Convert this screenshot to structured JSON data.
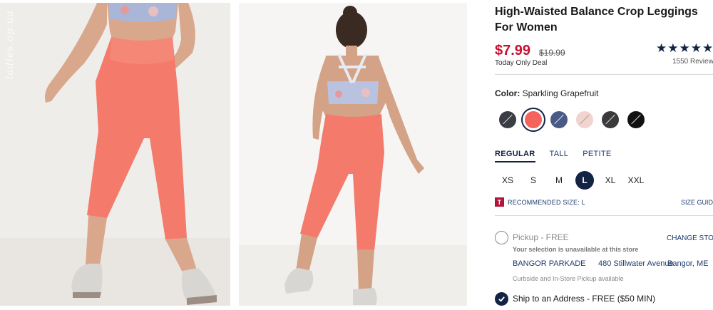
{
  "images": {
    "front": {
      "name": "front-view"
    },
    "back": {
      "name": "back-view"
    },
    "watermark": "ladies.op.ua"
  },
  "product": {
    "title": "High-Waisted Balance Crop Leggings For Women",
    "price": "$7.99",
    "original_price": "$19.99",
    "deal": "Today Only Deal",
    "stars": "★★★★★",
    "rating": 4.5,
    "reviews": "1550 Review"
  },
  "color": {
    "label": "Color:",
    "value": "Sparkling Grapefruit",
    "swatches": [
      {
        "name": "charcoal-print",
        "color": "#3b3d44"
      },
      {
        "name": "sparkling-grapefruit",
        "color": "#f4635c",
        "selected": true
      },
      {
        "name": "blue-heather",
        "color": "#4a5a86"
      },
      {
        "name": "floral-print",
        "color": "#f2d4cf"
      },
      {
        "name": "dark-gray",
        "color": "#3a3a3a"
      },
      {
        "name": "black",
        "color": "#111111"
      }
    ]
  },
  "fit": {
    "tabs": [
      "REGULAR",
      "TALL",
      "PETITE"
    ],
    "active": "REGULAR"
  },
  "sizes": {
    "options": [
      "XS",
      "S",
      "M",
      "L",
      "XL",
      "XXL"
    ],
    "selected": "L"
  },
  "recommended": {
    "badge": "T",
    "text": "RECOMMENDED SIZE: L",
    "size_guide": "SIZE GUID"
  },
  "fulfillment": {
    "pickup_label": "Pickup - FREE",
    "change_store": "CHANGE STOR",
    "unavailable": "Your selection is unavailable at this store",
    "store_name": "BANGOR PARKADE",
    "store_address": "480 Stillwater Avenue",
    "store_city": "Bangor, ME",
    "curbside": "Curbside and In-Store Pickup available",
    "ship_label": "Ship to an Address - FREE ($50 MIN)"
  },
  "colors": {
    "brand_navy": "#122344",
    "sale_red": "#c8102e",
    "legging_coral": "#f47a6b"
  }
}
